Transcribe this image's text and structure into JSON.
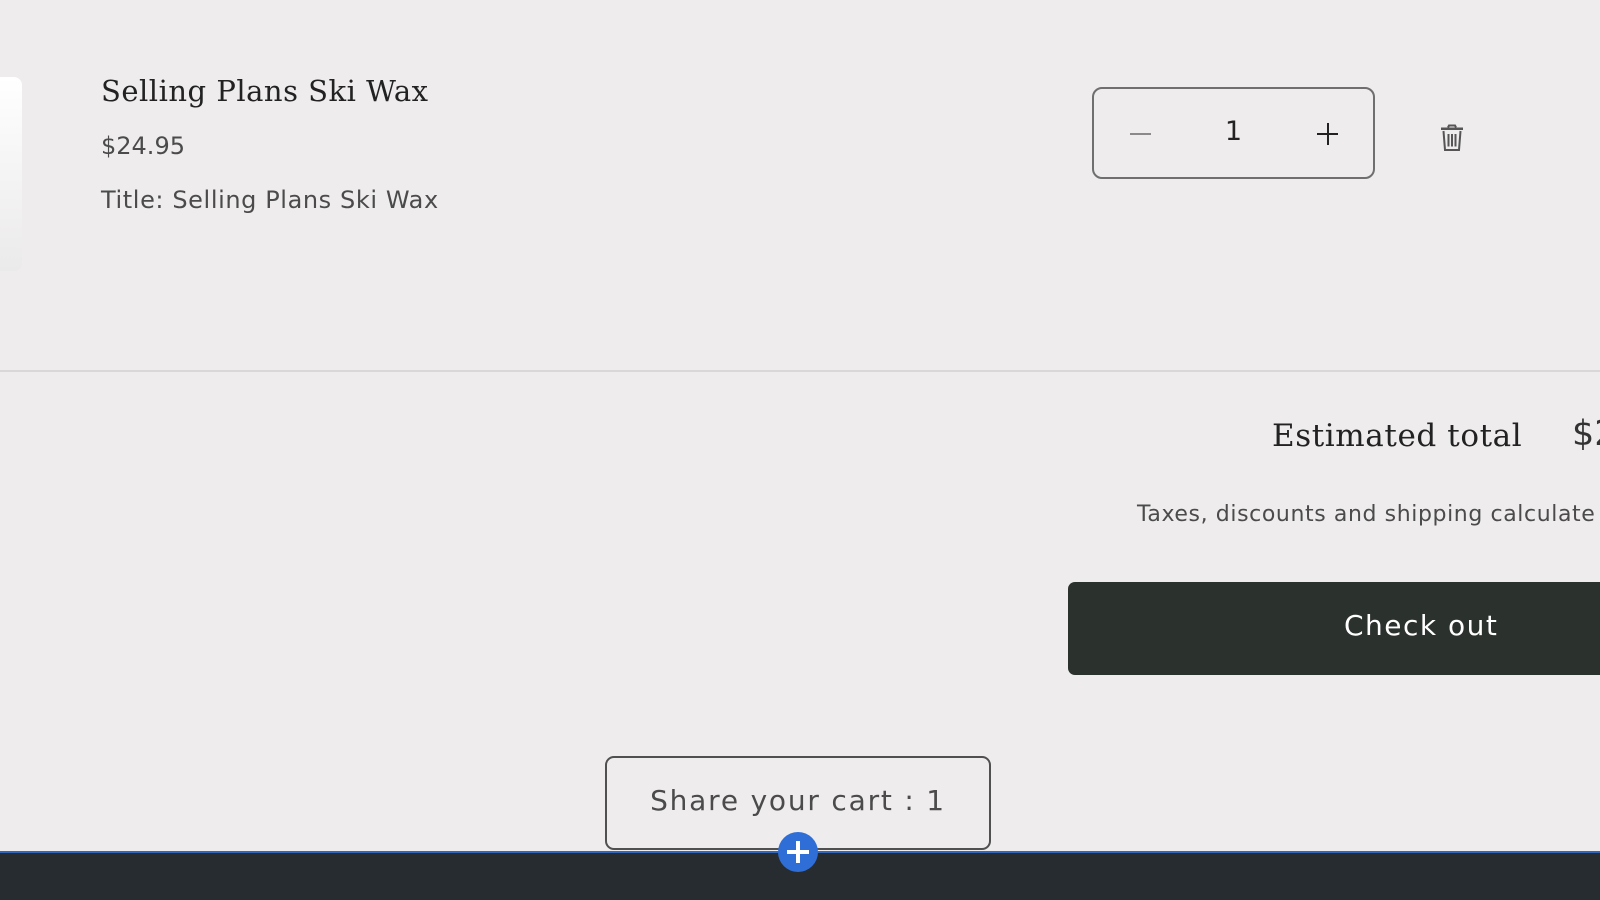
{
  "cart_item": {
    "name": "Selling Plans Ski Wax",
    "price": "$24.95",
    "option": "Title: Selling Plans Ski Wax",
    "quantity": "1"
  },
  "summary": {
    "total_label": "Estimated total",
    "total_value": "$2",
    "tax_note": "Taxes, discounts and shipping calculate",
    "checkout_label": "Check out"
  },
  "share": {
    "label": "Share your cart : 1"
  },
  "icons": {
    "quantity_decrease": "minus-icon",
    "quantity_increase": "plus-icon",
    "remove_item": "trash-icon",
    "add_section": "plus-circle-icon"
  },
  "colors": {
    "page_background": "#eeeced",
    "checkout_button": "#2b312d",
    "footer": "#262c30",
    "editor_accent": "#2f6ed6"
  }
}
